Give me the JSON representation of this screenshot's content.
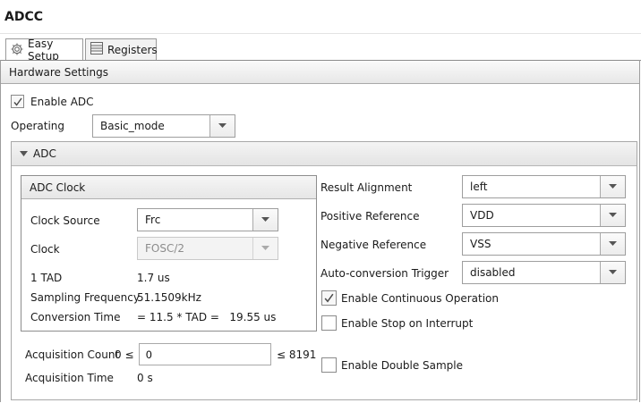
{
  "window": {
    "title": "ADCC"
  },
  "tabs": [
    {
      "label": "Easy Setup",
      "icon": "gear-icon",
      "active": true
    },
    {
      "label": "Registers",
      "icon": "table-icon",
      "active": false
    }
  ],
  "hardware_settings": {
    "header": "Hardware Settings",
    "enable_adc": {
      "label": "Enable ADC",
      "checked": true
    },
    "operating": {
      "label": "Operating",
      "value": "Basic_mode"
    }
  },
  "adc_section": {
    "title": "ADC",
    "clock": {
      "title": "ADC Clock",
      "clock_source": {
        "label": "Clock Source",
        "value": "Frc"
      },
      "clock": {
        "label": "Clock",
        "value": "FOSC/2",
        "disabled": true
      },
      "tad": {
        "label": "1 TAD",
        "value": "1.7 us"
      },
      "sampling_frequency": {
        "label": "Sampling Frequency",
        "value": "51.1509kHz"
      },
      "conversion_time": {
        "label": "Conversion Time",
        "value": "= 11.5 * TAD =   19.55 us"
      }
    },
    "acquisition_count": {
      "label": "Acquisition Count",
      "prefix": "0 ≤",
      "value": "0",
      "suffix": "≤ 8191"
    },
    "acquisition_time": {
      "label": "Acquisition Time",
      "value": "0 s"
    },
    "result_alignment": {
      "label": "Result Alignment",
      "value": "left"
    },
    "positive_reference": {
      "label": "Positive Reference",
      "value": "VDD"
    },
    "negative_reference": {
      "label": "Negative Reference",
      "value": "VSS"
    },
    "auto_conversion_trigger": {
      "label": "Auto-conversion Trigger",
      "value": "disabled"
    },
    "enable_continuous_operation": {
      "label": "Enable Continuous Operation",
      "checked": true
    },
    "enable_stop_on_interrupt": {
      "label": "Enable Stop on Interrupt",
      "checked": false
    },
    "enable_double_sample": {
      "label": "Enable Double Sample",
      "checked": false
    }
  }
}
